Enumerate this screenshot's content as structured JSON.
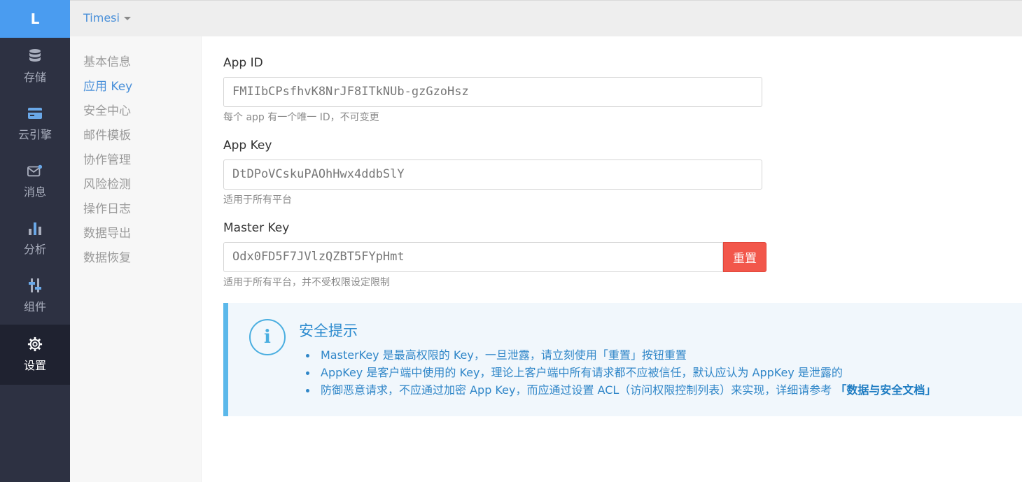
{
  "rail": {
    "logo": "L",
    "items": [
      {
        "label": "存储",
        "icon": "database-icon"
      },
      {
        "label": "云引擎",
        "icon": "card-icon"
      },
      {
        "label": "消息",
        "icon": "message-icon"
      },
      {
        "label": "分析",
        "icon": "bar-chart-icon"
      },
      {
        "label": "组件",
        "icon": "sliders-icon"
      },
      {
        "label": "设置",
        "icon": "gear-icon",
        "active": true
      }
    ]
  },
  "topbar": {
    "app_name": "Timesi"
  },
  "subnav": {
    "items": [
      {
        "label": "基本信息"
      },
      {
        "label": "应用 Key",
        "active": true
      },
      {
        "label": "安全中心"
      },
      {
        "label": "邮件模板"
      },
      {
        "label": "协作管理"
      },
      {
        "label": "风险检测"
      },
      {
        "label": "操作日志"
      },
      {
        "label": "数据导出"
      },
      {
        "label": "数据恢复"
      }
    ]
  },
  "fields": {
    "app_id": {
      "label": "App ID",
      "value": "FMIIbCPsfhvK8NrJF8ITkNUb-gzGzoHsz",
      "help": "每个 app 有一个唯一 ID，不可变更"
    },
    "app_key": {
      "label": "App Key",
      "value": "DtDPoVCskuPAOhHwx4ddbSlY",
      "help": "适用于所有平台"
    },
    "master_key": {
      "label": "Master Key",
      "value": "Odx0FD5F7JVlzQZBT5FYpHmt",
      "help": "适用于所有平台，并不受权限设定限制",
      "reset_label": "重置"
    }
  },
  "notice": {
    "title": "安全提示",
    "icon": "info-icon",
    "items": [
      "MasterKey 是最高权限的 Key，一旦泄露，请立刻使用「重置」按钮重置",
      "AppKey 是客户端中使用的 Key，理论上客户端中所有请求都不应被信任，默认应认为 AppKey 是泄露的",
      "防御恶意请求，不应通过加密 App Key，而应通过设置 ACL（访问权限控制列表）来实现，详细请参考 "
    ],
    "doc_link": "「数据与安全文档」"
  },
  "colors": {
    "rail_bg": "#2d3142",
    "logo_bg": "#4a9cf0",
    "accent": "#4a90d9",
    "danger": "#f2574b",
    "notice_border": "#5bb8ea"
  }
}
